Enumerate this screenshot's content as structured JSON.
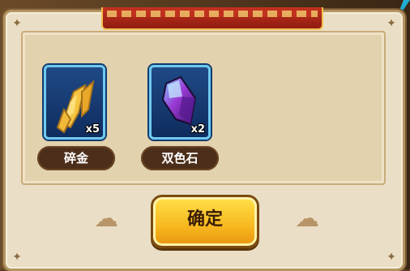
{
  "dialog": {
    "title_text": "",
    "items": [
      {
        "name": "碎金",
        "count": "x5",
        "icon": "gold-shard-icon"
      },
      {
        "name": "双色石",
        "count": "x2",
        "icon": "purple-crystal-icon"
      }
    ],
    "confirm_label": "确定"
  },
  "colors": {
    "accent": "#f7b81e",
    "frame_blue": "#6ec9f0",
    "panel_bg": "#eadfc6"
  }
}
